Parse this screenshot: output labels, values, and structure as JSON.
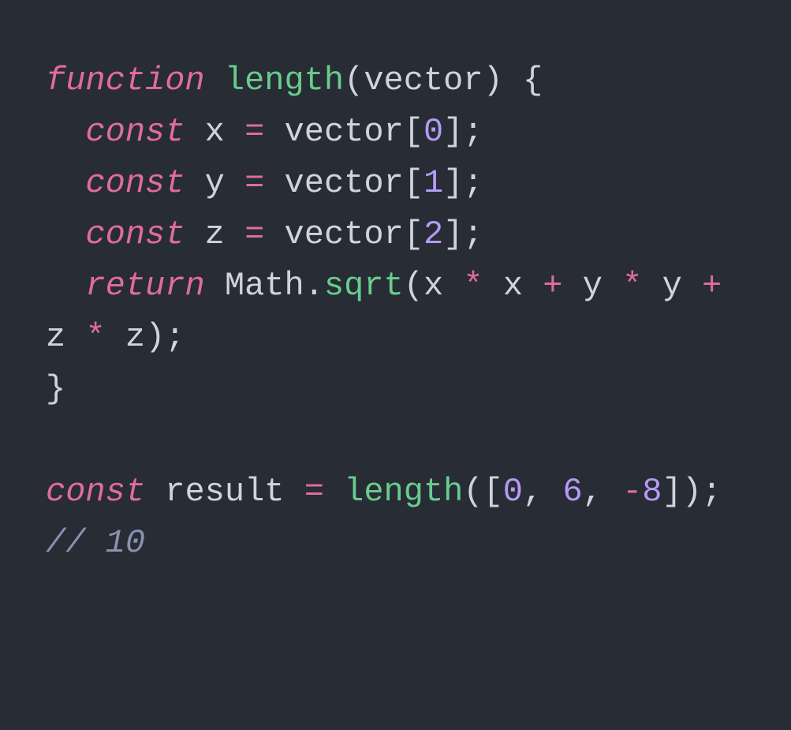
{
  "tokens": [
    {
      "cls": "kw",
      "t": "function"
    },
    {
      "cls": "pun",
      "t": " "
    },
    {
      "cls": "fn",
      "t": "length"
    },
    {
      "cls": "pun",
      "t": "("
    },
    {
      "cls": "id",
      "t": "vector"
    },
    {
      "cls": "pun",
      "t": ") {"
    },
    {
      "cls": "nl"
    },
    {
      "cls": "pun",
      "t": "  "
    },
    {
      "cls": "kw",
      "t": "const"
    },
    {
      "cls": "pun",
      "t": " "
    },
    {
      "cls": "id",
      "t": "x"
    },
    {
      "cls": "pun",
      "t": " "
    },
    {
      "cls": "op",
      "t": "="
    },
    {
      "cls": "pun",
      "t": " "
    },
    {
      "cls": "id",
      "t": "vector"
    },
    {
      "cls": "pun",
      "t": "["
    },
    {
      "cls": "num",
      "t": "0"
    },
    {
      "cls": "pun",
      "t": "];"
    },
    {
      "cls": "nl"
    },
    {
      "cls": "pun",
      "t": "  "
    },
    {
      "cls": "kw",
      "t": "const"
    },
    {
      "cls": "pun",
      "t": " "
    },
    {
      "cls": "id",
      "t": "y"
    },
    {
      "cls": "pun",
      "t": " "
    },
    {
      "cls": "op",
      "t": "="
    },
    {
      "cls": "pun",
      "t": " "
    },
    {
      "cls": "id",
      "t": "vector"
    },
    {
      "cls": "pun",
      "t": "["
    },
    {
      "cls": "num",
      "t": "1"
    },
    {
      "cls": "pun",
      "t": "];"
    },
    {
      "cls": "nl"
    },
    {
      "cls": "pun",
      "t": "  "
    },
    {
      "cls": "kw",
      "t": "const"
    },
    {
      "cls": "pun",
      "t": " "
    },
    {
      "cls": "id",
      "t": "z"
    },
    {
      "cls": "pun",
      "t": " "
    },
    {
      "cls": "op",
      "t": "="
    },
    {
      "cls": "pun",
      "t": " "
    },
    {
      "cls": "id",
      "t": "vector"
    },
    {
      "cls": "pun",
      "t": "["
    },
    {
      "cls": "num",
      "t": "2"
    },
    {
      "cls": "pun",
      "t": "];"
    },
    {
      "cls": "nl"
    },
    {
      "cls": "pun",
      "t": "  "
    },
    {
      "cls": "kw",
      "t": "return"
    },
    {
      "cls": "pun",
      "t": " "
    },
    {
      "cls": "prop",
      "t": "Math"
    },
    {
      "cls": "pun",
      "t": "."
    },
    {
      "cls": "fn",
      "t": "sqrt"
    },
    {
      "cls": "pun",
      "t": "("
    },
    {
      "cls": "id",
      "t": "x"
    },
    {
      "cls": "pun",
      "t": " "
    },
    {
      "cls": "op",
      "t": "*"
    },
    {
      "cls": "pun",
      "t": " "
    },
    {
      "cls": "id",
      "t": "x"
    },
    {
      "cls": "pun",
      "t": " "
    },
    {
      "cls": "op",
      "t": "+"
    },
    {
      "cls": "pun",
      "t": " "
    },
    {
      "cls": "id",
      "t": "y"
    },
    {
      "cls": "pun",
      "t": " "
    },
    {
      "cls": "op",
      "t": "*"
    },
    {
      "cls": "pun",
      "t": " "
    },
    {
      "cls": "id",
      "t": "y"
    },
    {
      "cls": "pun",
      "t": " "
    },
    {
      "cls": "op",
      "t": "+"
    },
    {
      "cls": "pun",
      "t": " "
    },
    {
      "cls": "id",
      "t": "z"
    },
    {
      "cls": "pun",
      "t": " "
    },
    {
      "cls": "op",
      "t": "*"
    },
    {
      "cls": "pun",
      "t": " "
    },
    {
      "cls": "id",
      "t": "z"
    },
    {
      "cls": "pun",
      "t": ");"
    },
    {
      "cls": "nl"
    },
    {
      "cls": "pun",
      "t": "}"
    },
    {
      "cls": "nl"
    },
    {
      "cls": "nl"
    },
    {
      "cls": "kw",
      "t": "const"
    },
    {
      "cls": "pun",
      "t": " "
    },
    {
      "cls": "id",
      "t": "result"
    },
    {
      "cls": "pun",
      "t": " "
    },
    {
      "cls": "op",
      "t": "="
    },
    {
      "cls": "pun",
      "t": " "
    },
    {
      "cls": "fn",
      "t": "length"
    },
    {
      "cls": "pun",
      "t": "(["
    },
    {
      "cls": "num",
      "t": "0"
    },
    {
      "cls": "pun",
      "t": ", "
    },
    {
      "cls": "num",
      "t": "6"
    },
    {
      "cls": "pun",
      "t": ", "
    },
    {
      "cls": "op",
      "t": "-"
    },
    {
      "cls": "num",
      "t": "8"
    },
    {
      "cls": "pun",
      "t": "]);"
    },
    {
      "cls": "nl"
    },
    {
      "cls": "cmt",
      "t": "// 10"
    }
  ]
}
